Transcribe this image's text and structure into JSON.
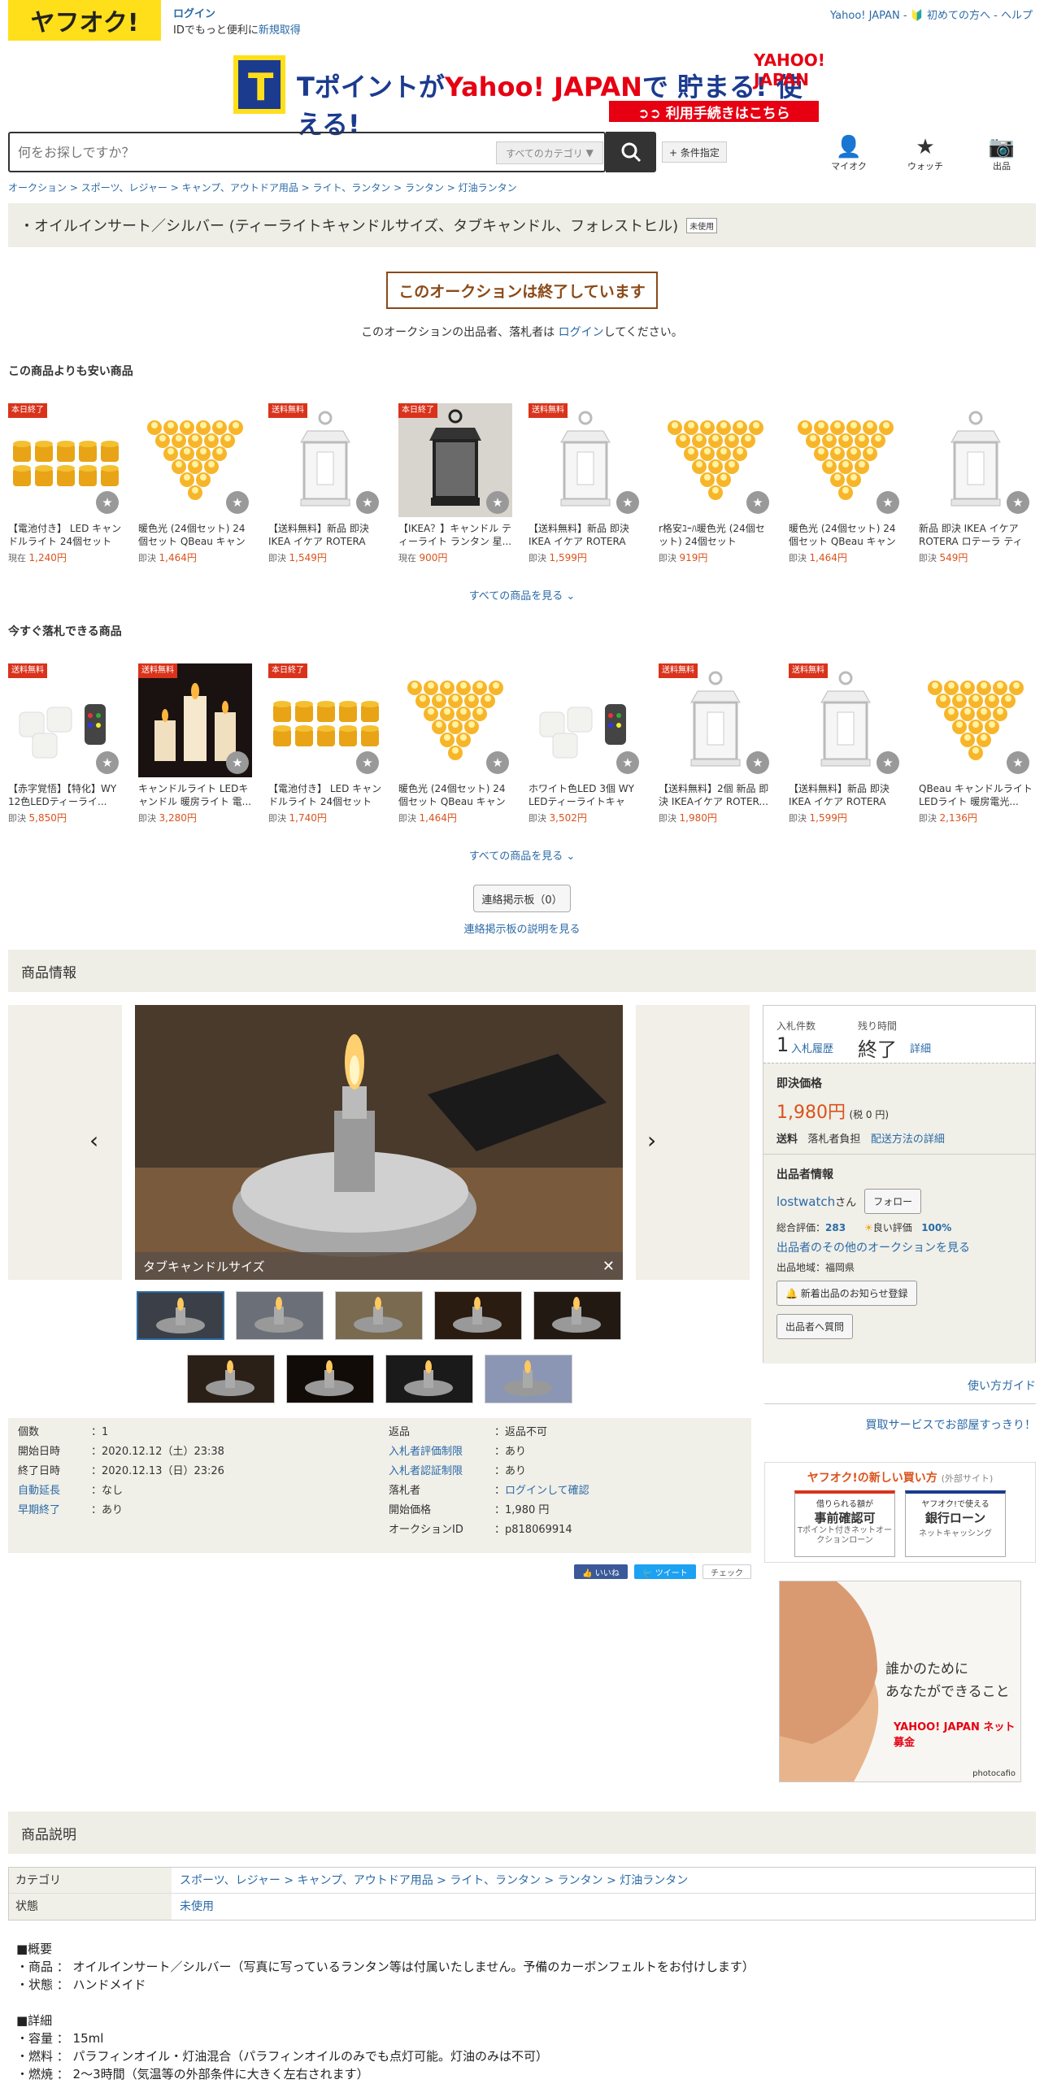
{
  "header": {
    "logo": "ヤフオク!",
    "login": "ログイン",
    "login_sub_prefix": "IDでもっと便利に",
    "signup": "新規取得",
    "right_links": "Yahoo! JAPAN - 🔰 初めての方へ - ヘルプ"
  },
  "banner": {
    "t_letter": "T",
    "text_a": "Tポイントが",
    "text_b": "Yahoo! JAPAN",
    "text_c": "で 貯まる! 使える!",
    "sub": "➲➲ 利用手続きはこちら",
    "ylogo": "YAHOO! JAPAN"
  },
  "search": {
    "placeholder": "何をお探しですか？",
    "category": "すべてのカテゴリ",
    "conditions": "+ 条件指定"
  },
  "nav": [
    {
      "label": "マイオク",
      "icon": "person-icon"
    },
    {
      "label": "ウォッチ",
      "icon": "star-icon"
    },
    {
      "label": "出品",
      "icon": "camera-icon"
    }
  ],
  "breadcrumb": "オークション > スポーツ、レジャー > キャンプ、アウトドア用品 > ライト、ランタン > ランタン > 灯油ランタン",
  "item_title": "・オイルインサート／シルバー (ティーライトキャンドルサイズ、タブキャンドル、フォレストヒル)",
  "condition_tag": "未使用",
  "ended_text": "このオークションは終了しています",
  "ended_note_a": "このオークションの出品者、落札者は ",
  "ended_note_link": "ログイン",
  "ended_note_b": "してください。",
  "cheaper": {
    "title": "この商品よりも安い商品",
    "see_all": "すべての商品を見る ⌄",
    "items": [
      {
        "badge": "本日終了",
        "title": "【電池付き】 LED キャンドルライト 24個セット ...",
        "price_label": "現在",
        "price": "1,240円",
        "img": "candles"
      },
      {
        "badge": "",
        "title": "暖色光 (24個セット) 24個セット QBeau キャンド...",
        "price_label": "即決",
        "price": "1,464円",
        "img": "triangle"
      },
      {
        "badge": "送料無料",
        "title": "【送料無料】新品 即決 IKEA イケア ROTERA ロ...",
        "price_label": "即決",
        "price": "1,549円",
        "img": "lantern"
      },
      {
        "badge": "本日終了",
        "title": "【IKEA？】キャンドル ティーライト ランタン 星...",
        "price_label": "現在",
        "price": "900円",
        "img": "darklantern"
      },
      {
        "badge": "送料無料",
        "title": "【送料無料】新品 即決 IKEA イケア ROTERA ロ...",
        "price_label": "即決",
        "price": "1,599円",
        "img": "lantern"
      },
      {
        "badge": "",
        "title": "r格安ﾕｰﾊ暖色光 (24個セット) 24個セット QBea...",
        "price_label": "即決",
        "price": "919円",
        "img": "triangle"
      },
      {
        "badge": "",
        "title": "暖色光 (24個セット) 24個セット QBeau キャンド...",
        "price_label": "即決",
        "price": "1,464円",
        "img": "triangle"
      },
      {
        "badge": "",
        "title": "新品 即決 IKEA イケア ROTERA ロテーラ ティー...",
        "price_label": "即決",
        "price": "549円",
        "img": "lantern"
      }
    ]
  },
  "buynow": {
    "title": "今すぐ落札できる商品",
    "see_all": "すべての商品を見る ⌄",
    "items": [
      {
        "badge": "送料無料",
        "title": "【赤字覚悟】【特化】WY 12色LEDティーライ...",
        "price_label": "即決",
        "price": "5,850円",
        "img": "whitecandles"
      },
      {
        "badge": "送料無料",
        "title": "キャンドルライト LEDキャンドル 暖房ライト 電...",
        "price_label": "即決",
        "price": "3,280円",
        "img": "pillars"
      },
      {
        "badge": "本日終了",
        "title": "【電池付き】 LED キャンドルライト 24個セット ...",
        "price_label": "即決",
        "price": "1,740円",
        "img": "candles"
      },
      {
        "badge": "",
        "title": "暖色光 (24個セット) 24個セット QBeau キャンド...",
        "price_label": "即決",
        "price": "1,464円",
        "img": "triangle"
      },
      {
        "badge": "",
        "title": "ホワイト色LED 3個 WY LEDティーライトキャン...",
        "price_label": "即決",
        "price": "3,502円",
        "img": "whitecandles"
      },
      {
        "badge": "送料無料",
        "title": "【送料無料】2個 新品 即決 IKEAイケア ROTER...",
        "price_label": "即決",
        "price": "1,980円",
        "img": "lantern"
      },
      {
        "badge": "送料無料",
        "title": "【送料無料】新品 即決 IKEA イケア ROTERA ロ...",
        "price_label": "即決",
        "price": "1,599円",
        "img": "lantern"
      },
      {
        "badge": "",
        "title": "QBeau キャンドルライト LEDライト 暖房電光...",
        "price_label": "即決",
        "price": "2,136円",
        "img": "triangle"
      }
    ]
  },
  "board": {
    "button": "連絡掲示板（0）",
    "note": "連絡掲示板の説明を見る"
  },
  "product_info_title": "商品情報",
  "main_image_caption": "タブキャンドルサイズ",
  "panel": {
    "bids_label": "入札件数",
    "bids": "1",
    "bid_history": "入札履歴",
    "remaining_label": "残り時間",
    "remaining": "終了",
    "detail": "詳細",
    "buynow_title": "即決価格",
    "price": "1,980円",
    "tax": "(税 0 円)",
    "shipping_label": "送料",
    "shipping": "落札者負担",
    "shipping_link": "配送方法の詳細",
    "seller_title": "出品者情報",
    "seller": "lostwatch",
    "seller_suffix": "さん",
    "follow": "フォロー",
    "rating_label": "総合評価：",
    "rating": "283",
    "good_label": "良い評価",
    "good": "100%",
    "other_auctions": "出品者のその他のオークションを見る",
    "region": "出品地域：福岡県",
    "notify": "🔔 新着出品のお知らせ登録",
    "question": "出品者へ質問"
  },
  "usage_guide": "使い方ガイド",
  "buyback": "買取サービスでお部屋すっきり！",
  "newway": {
    "title": "ヤフオク!の新しい買い方",
    "external": "(外部サイト)",
    "b1_top": "借りられる額が",
    "b1_main": "事前確認可",
    "b1_sub": "Tポイント付きネットオークションローン",
    "b2_top": "ヤフオク!で使える",
    "b2_main": "銀行ローン",
    "b2_sub": "ネットキャッシング"
  },
  "ad": {
    "line1": "誰かのために",
    "line2": "あなたができること",
    "brand": "YAHOO! JAPAN ネット募金",
    "credit": "photocafio"
  },
  "details": {
    "left": [
      {
        "k": "個数",
        "v": "1",
        "link": false
      },
      {
        "k": "開始日時",
        "v": "2020.12.12（土）23:38",
        "link": false
      },
      {
        "k": "終了日時",
        "v": "2020.12.13（日）23:26",
        "link": false
      },
      {
        "k": "自動延長",
        "v": "なし",
        "link": true
      },
      {
        "k": "早期終了",
        "v": "あり",
        "link": true
      }
    ],
    "right": [
      {
        "k": "返品",
        "v": "返品不可",
        "link": false,
        "vlink": false
      },
      {
        "k": "入札者評価制限",
        "v": "あり",
        "link": true,
        "vlink": false
      },
      {
        "k": "入札者認証制限",
        "v": "あり",
        "link": true,
        "vlink": false
      },
      {
        "k": "落札者",
        "v": "ログインして確認",
        "link": false,
        "vlink": true
      },
      {
        "k": "開始価格",
        "v": "1,980 円",
        "link": false,
        "vlink": false
      },
      {
        "k": "オークションID",
        "v": "p818069914",
        "link": false,
        "vlink": false
      }
    ]
  },
  "share": {
    "like": "👍 いいね",
    "tweet": "🐦 ツイート",
    "check": "チェック"
  },
  "description_title": "商品説明",
  "desc_table": {
    "category_label": "カテゴリ",
    "category": "スポーツ、レジャー > キャンプ、アウトドア用品 > ライト、ランタン > ランタン > 灯油ランタン",
    "condition_label": "状態",
    "condition": "未使用"
  },
  "desc_body": [
    "■概要",
    "・商品 ： オイルインサート／シルバー（写真に写っているランタン等は付属いたしません。予備のカーボンフェルトをお付けします）",
    "・状態 ： ハンドメイド",
    "",
    "■詳細",
    "・容量 ： 15ml",
    "・燃料 ： パラフィンオイル・灯油混合（パラフィンオイルのみでも点灯可能。灯油のみは不可）",
    "・燃焼 ： 2～3時間（気温等の外部条件に大きく左右されます）"
  ]
}
